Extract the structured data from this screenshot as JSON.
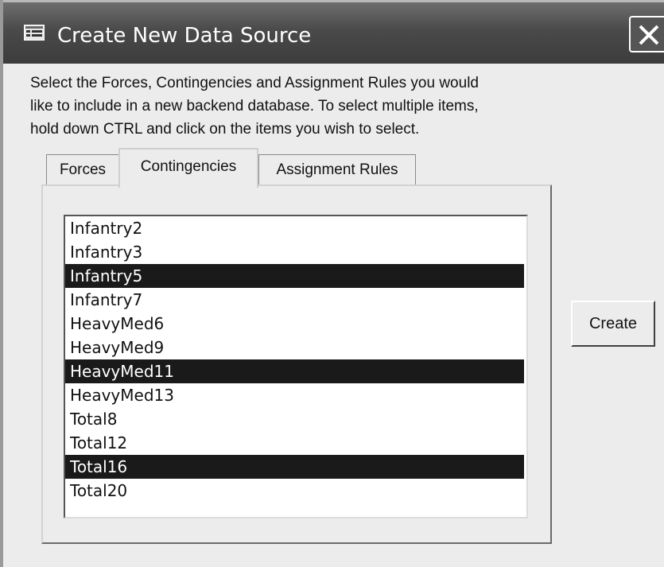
{
  "window": {
    "title": "Create New Data Source",
    "title_icon": "form-icon",
    "close_icon": "close-icon"
  },
  "instructions": {
    "line1": "Select the Forces, Contingencies and Assignment Rules you would",
    "line2": "like to include in a new backend database. To select multiple items,",
    "line3": "hold down CTRL and click on the items you wish to select."
  },
  "tabs": [
    {
      "label": "Forces"
    },
    {
      "label": "Contingencies",
      "active": true
    },
    {
      "label": "Assignment Rules"
    }
  ],
  "list": {
    "items": [
      {
        "label": "Infantry2",
        "selected": false
      },
      {
        "label": "Infantry3",
        "selected": false
      },
      {
        "label": "Infantry5",
        "selected": true
      },
      {
        "label": "Infantry7",
        "selected": false
      },
      {
        "label": "HeavyMed6",
        "selected": false
      },
      {
        "label": "HeavyMed9",
        "selected": false
      },
      {
        "label": "HeavyMed11",
        "selected": true
      },
      {
        "label": "HeavyMed13",
        "selected": false
      },
      {
        "label": "Total8",
        "selected": false
      },
      {
        "label": "Total12",
        "selected": false
      },
      {
        "label": "Total16",
        "selected": true
      },
      {
        "label": "Total20",
        "selected": false
      }
    ]
  },
  "buttons": {
    "create_label": "Create"
  }
}
